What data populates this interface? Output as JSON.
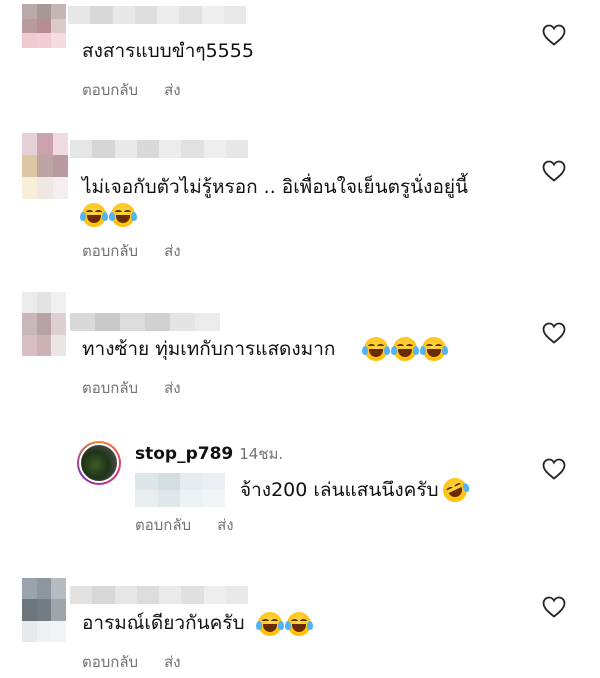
{
  "comments": [
    {
      "text": "สงสารแบบขำๆ5555",
      "reply_label": "ตอบกลับ",
      "share_label": "ส่ง",
      "emoji_count": 0
    },
    {
      "text": "ไม่เจอกับตัวไม่รู้หรอก .. อิเพื่อนใจเย็นตรูนั่งอยู่นี้",
      "reply_label": "ตอบกลับ",
      "share_label": "ส่ง",
      "emoji_count": 2
    },
    {
      "text": "ทางซ้าย ทุ่มเทกับการแสดงมาก",
      "reply_label": "ตอบกลับ",
      "share_label": "ส่ง",
      "emoji_count": 3
    },
    {
      "text": "อารมณ์เดียวกันครับ",
      "reply_label": "ตอบกลับ",
      "share_label": "ส่ง",
      "emoji_count": 2
    }
  ],
  "reply": {
    "username": "stop_p789",
    "time": "14ชม.",
    "text": "จ้าง200 เล่นแสนนึงครับ",
    "reply_label": "ตอบกลับ",
    "share_label": "ส่ง"
  },
  "icons": {
    "like": "heart-icon",
    "emoji_laugh": "face-with-tears-of-joy-icon",
    "emoji_rofl": "rolling-on-the-floor-laughing-icon"
  },
  "colors": {
    "text": "#111111",
    "secondary": "#737373",
    "heart_stroke": "#262626"
  }
}
